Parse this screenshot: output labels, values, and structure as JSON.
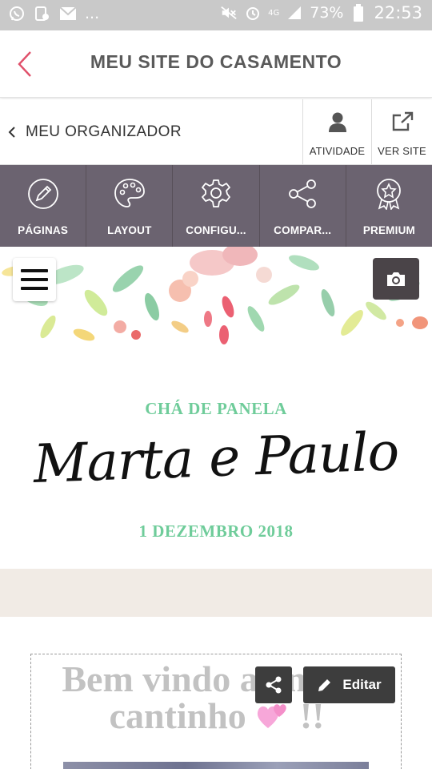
{
  "status_bar": {
    "icons": [
      "whatsapp-icon",
      "bluetooth-device-icon",
      "gmail-icon",
      "more-dots-icon",
      "mute-icon",
      "alarm-icon",
      "4g-icon",
      "signal-icon",
      "battery-icon"
    ],
    "more": "...",
    "network": "4G",
    "battery": "73%",
    "time": "22:53"
  },
  "header": {
    "title": "MEU SITE DO CASAMENTO",
    "back_icon": "chevron-left-icon",
    "accent_color": "#e0506a"
  },
  "organizer": {
    "back_label": "MEU ORGANIZADOR",
    "activity_label": "ATIVIDADE",
    "activity_icon": "person-icon",
    "view_site_label": "VER SITE",
    "view_site_icon": "external-link-icon"
  },
  "toolbar": {
    "background": "#6b6370",
    "items": [
      {
        "label": "PÁGINAS",
        "icon": "pencil-icon"
      },
      {
        "label": "LAYOUT",
        "icon": "palette-icon"
      },
      {
        "label": "CONFIGU...",
        "icon": "gear-icon"
      },
      {
        "label": "COMPAR...",
        "icon": "share-icon"
      },
      {
        "label": "PREMIUM",
        "icon": "award-star-icon"
      }
    ]
  },
  "banner": {
    "event": "CHÁ DE PANELA",
    "couple": "Marta e Paulo",
    "date": "1 DEZEMBRO 2018",
    "accent_color": "#6fcc9a",
    "menu_icon": "hamburger-menu-icon",
    "camera_icon": "camera-icon"
  },
  "welcome": {
    "line1": "Bem vindo ao nosso",
    "line2": "cantinho",
    "emoji": "💞",
    "suffix": "!!",
    "share_icon": "share-icon",
    "edit_icon": "pencil-icon",
    "edit_label": "Editar"
  }
}
